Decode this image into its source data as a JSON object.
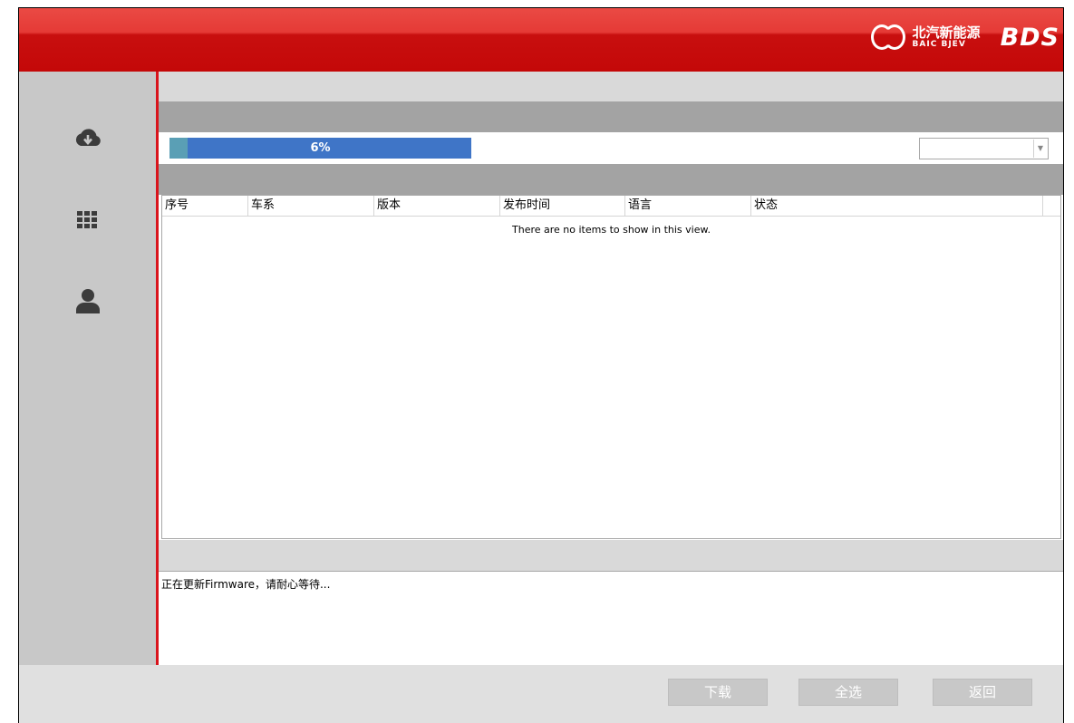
{
  "header": {
    "logo_cn": "北汽新能源",
    "logo_en": "BAIC BJEV",
    "logo_bds": "BDS",
    "background_color": "#c40808"
  },
  "sidebar": {
    "items": [
      {
        "icon": "cloud-download-icon"
      },
      {
        "icon": "grid-apps-icon"
      },
      {
        "icon": "user-icon"
      }
    ]
  },
  "progress": {
    "label": "6%",
    "value": 0.06
  },
  "version_select": {
    "selected": ""
  },
  "list": {
    "columns": [
      "序号",
      "车系",
      "版本",
      "发布时间",
      "语言",
      "状态"
    ],
    "rows": [],
    "empty_message": "There are no items to show in this view."
  },
  "log": {
    "message": "正在更新Firmware，请耐心等待..."
  },
  "buttons": {
    "download": "下载",
    "select_all": "全选",
    "back": "返回"
  }
}
